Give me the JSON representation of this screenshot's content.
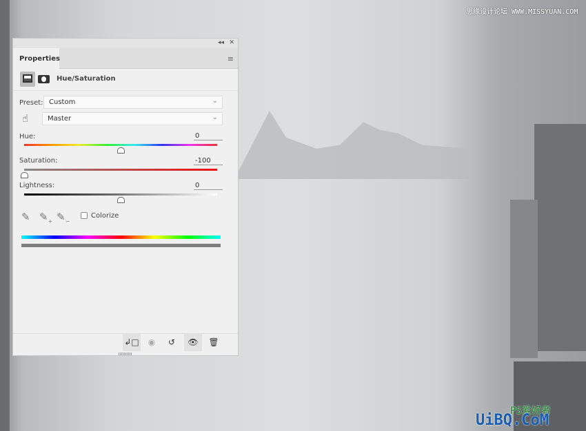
{
  "watermark": {
    "top": "思缘设计论坛 WWW.MISSYUAN.COM",
    "bottom_logo": "PS爱好者",
    "bottom_site": "UiBQ.CoM"
  },
  "panel": {
    "collapse_icon": "double-chevron-left",
    "close_icon": "close",
    "tab": "Properties",
    "menu_icon": "hamburger",
    "adjustment_title": "Hue/Saturation",
    "preset_label": "Preset:",
    "preset_value": "Custom",
    "channel_value": "Master",
    "hue": {
      "label": "Hue:",
      "value": "0",
      "fraction": 0.5
    },
    "saturation": {
      "label": "Saturation:",
      "value": "-100",
      "fraction": 0.0
    },
    "lightness": {
      "label": "Lightness:",
      "value": "0",
      "fraction": 0.5
    },
    "colorize_label": "Colorize",
    "colorize_checked": false
  }
}
